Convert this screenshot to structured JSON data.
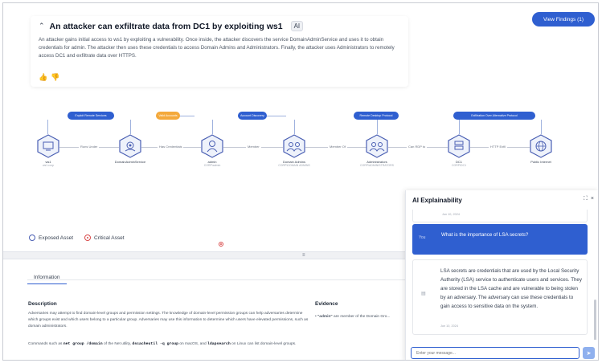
{
  "finding": {
    "title": "An attacker can exfiltrate data from DC1 by exploiting ws1",
    "ai_chip": "AI",
    "description": "An attacker gains initial access to ws1 by exploiting a vulnerability. Once inside, the attacker discovers the service DomainAdminService and uses it to obtain credentials for admin. The attacker then uses these credentials to access Domain Admins and Administrators. Finally, the attacker uses Administrators to remotely access DC1 and exfiltrate data over HTTPS.",
    "thumbs_up": "👍",
    "thumbs_down": "👎"
  },
  "view_findings_label": "View Findings (1)",
  "graph": {
    "techniques": [
      {
        "label": "Exploit Remote Services",
        "color": "#2f5fd0"
      },
      {
        "label": "Valid Accounts",
        "color": "#f4a93b"
      },
      {
        "label": "Account Discovery",
        "color": "#2f5fd0"
      },
      {
        "label": "Remote Desktop Protocol",
        "color": "#2f5fd0"
      },
      {
        "label": "Exfiltration Over Alternative Protocol",
        "color": "#2f5fd0"
      }
    ],
    "nodes": [
      {
        "name": "ws1",
        "sub": "ws1.corp",
        "icon": "workstation-icon"
      },
      {
        "name": "DomainAdminService",
        "sub": "",
        "icon": "service-icon"
      },
      {
        "name": "admin",
        "sub": "CORP\\admin",
        "icon": "user-icon",
        "critical": true
      },
      {
        "name": "Domain Admins",
        "sub": "CORP\\DOMAIN ADMINS",
        "icon": "group-icon"
      },
      {
        "name": "Administrators",
        "sub": "CORP\\ADMINISTRATORS",
        "icon": "group-icon"
      },
      {
        "name": "DC1",
        "sub": "CORP\\DC1",
        "icon": "server-icon"
      },
      {
        "name": "Public Internet",
        "sub": "",
        "icon": "globe-icon"
      }
    ],
    "edges": [
      "Runs Under",
      "Has Credentials",
      "Member",
      "Member Of",
      "Can RDP to",
      "HTTP Exfil"
    ]
  },
  "legend": {
    "exposed": "Exposed Asset",
    "critical": "Critical Asset"
  },
  "tabs": {
    "information": "Information"
  },
  "description_section": {
    "title": "Description",
    "para1": "Adversaries may attempt to find domain-level groups and permission settings. The knowledge of domain-level permission groups can help adversaries determine which groups exist and which users belong to a particular group. Adversaries may use this information to determine which users have elevated permissions, such as domain administrators.",
    "para2_prefix": "Commands such as",
    "cmd1": "net group /domain",
    "para2_mid1": "of the Net utility,",
    "cmd2": "dscacheutil -q group",
    "para2_mid2": "on macOS, and",
    "cmd3": "ldapsearch",
    "para2_suffix": "on Linux can list domain-level groups."
  },
  "evidence_section": {
    "title": "Evidence",
    "bullet_user": "\"admin\"",
    "bullet_rest": "are member of the Domain Gro..."
  },
  "ai_panel": {
    "title": "AI Explainability",
    "ctrl_expand": "⛶",
    "ctrl_close": "×",
    "prev_timestamp": "Jun 10, 2024",
    "question": "What is the importance of LSA secrets?",
    "question_avatar": "You",
    "answer": "LSA secrets are credentials that are used by the Local Security Authority (LSA) service to authenticate users and services. They are stored in the LSA cache and are vulnerable to being stolen by an adversary. The adversary can use these credentials to gain access to sensitive data on the system.",
    "answer_timestamp": "Jun 10, 2024",
    "input_placeholder": "Enter your message...",
    "send_icon": "➤"
  }
}
